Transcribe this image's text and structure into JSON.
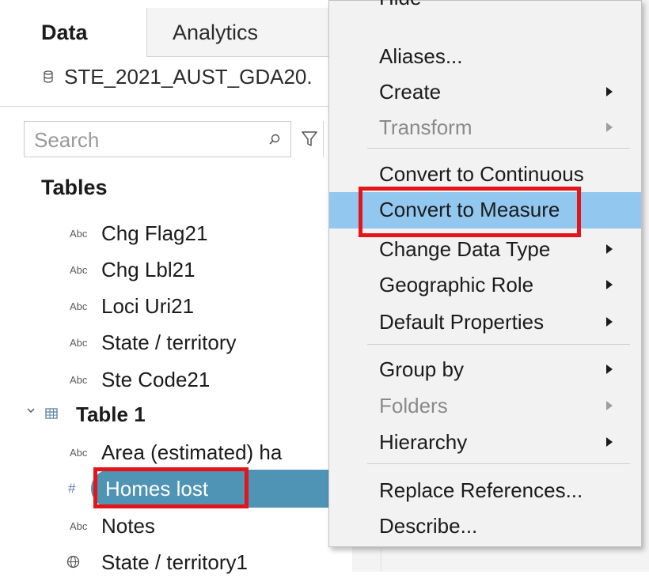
{
  "tabs": {
    "data": "Data",
    "analytics": "Analytics"
  },
  "datasource": {
    "name": "STE_2021_AUST_GDA20.",
    "icon": "database-icon"
  },
  "search": {
    "placeholder": "Search"
  },
  "tables_section": {
    "title": "Tables"
  },
  "fields_group1": [
    {
      "type": "Abc",
      "name": "Chg Flag21"
    },
    {
      "type": "Abc",
      "name": "Chg Lbl21"
    },
    {
      "type": "Abc",
      "name": "Loci Uri21"
    },
    {
      "type": "Abc",
      "name": "State / territory"
    },
    {
      "type": "Abc",
      "name": "Ste Code21"
    }
  ],
  "table1": {
    "name": "Table 1",
    "fields": [
      {
        "type": "Abc",
        "name": "Area (estimated) ha"
      },
      {
        "type": "#",
        "name": "Homes lost",
        "selected": true
      },
      {
        "type": "Abc",
        "name": "Notes"
      },
      {
        "type": "globe",
        "name": "State / territory1"
      }
    ]
  },
  "context_menu": {
    "items": [
      {
        "label": "Hide",
        "submenu": false,
        "disabled": false
      },
      {
        "label": "Aliases...",
        "submenu": false,
        "disabled": false
      },
      {
        "label": "Create",
        "submenu": true,
        "disabled": false
      },
      {
        "label": "Transform",
        "submenu": true,
        "disabled": true
      },
      {
        "label": "Convert to Continuous",
        "submenu": false,
        "disabled": false
      },
      {
        "label": "Convert to Measure",
        "submenu": false,
        "disabled": false,
        "highlighted": true
      },
      {
        "label": "Change Data Type",
        "submenu": true,
        "disabled": false
      },
      {
        "label": "Geographic Role",
        "submenu": true,
        "disabled": false
      },
      {
        "label": "Default Properties",
        "submenu": true,
        "disabled": false
      },
      {
        "label": "Group by",
        "submenu": true,
        "disabled": false
      },
      {
        "label": "Folders",
        "submenu": true,
        "disabled": true
      },
      {
        "label": "Hierarchy",
        "submenu": true,
        "disabled": false
      },
      {
        "label": "Replace References...",
        "submenu": false,
        "disabled": false
      },
      {
        "label": "Describe...",
        "submenu": false,
        "disabled": false
      }
    ]
  },
  "colors": {
    "highlight": "#92c7ef",
    "selected_pill": "#4f93b5",
    "annotation_red": "#e3151a"
  }
}
